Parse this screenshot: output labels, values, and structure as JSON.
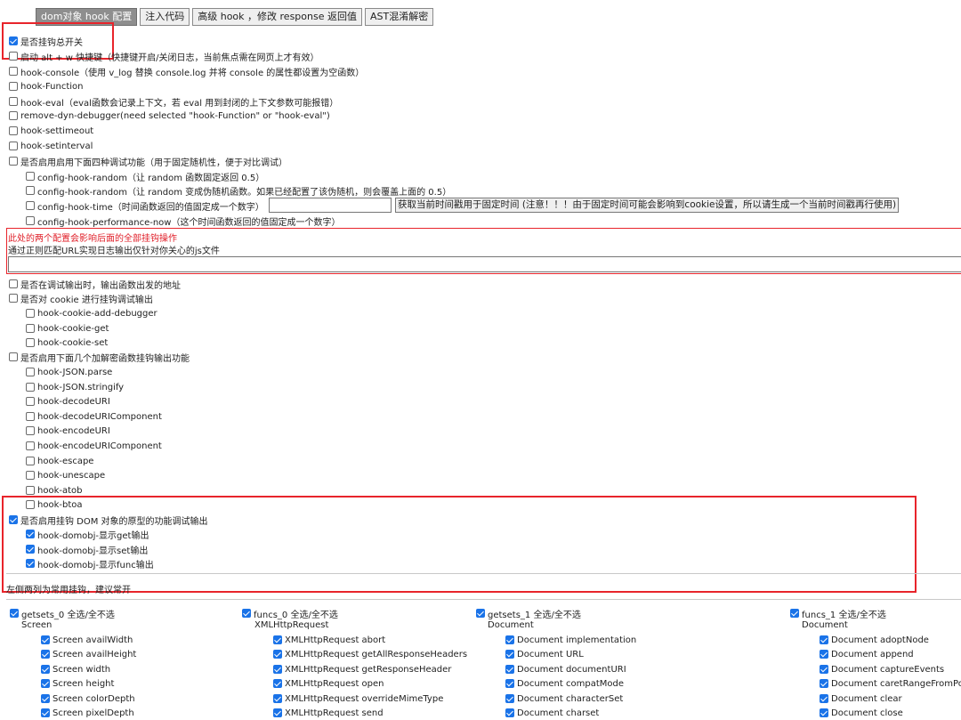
{
  "tabs": [
    {
      "label": "dom对象 hook 配置",
      "active": true
    },
    {
      "label": "注入代码",
      "active": false
    },
    {
      "label": "高级 hook ，修改 response 返回值",
      "active": false
    },
    {
      "label": "AST混淆解密",
      "active": false
    }
  ],
  "options": {
    "master": "是否挂钩总开关",
    "alt_w": "启动 alt + w 快捷键（快捷键开启/关闭日志，当前焦点需在网页上才有效）",
    "hook_console": "hook-console（使用 v_log 替换 console.log 并将 console 的属性都设置为空函数）",
    "hook_function": "hook-Function",
    "hook_eval": "hook-eval（eval函数会记录上下文，若 eval 用到封闭的上下文参数可能报错）",
    "remove_debugger": "remove-dyn-debugger(need selected \"hook-Function\" or \"hook-eval\")",
    "hook_settimeout": "hook-settimeout",
    "hook_setinterval": "hook-setinterval",
    "debug_group": "是否启用启用下面四种调试功能（用于固定随机性，便于对比调试）",
    "random1": "config-hook-random（让 random 函数固定返回 0.5）",
    "random2": "config-hook-random（让 random 变成伪随机函数。如果已经配置了该伪随机，则会覆盖上面的 0.5）",
    "time": "config-hook-time（时间函数返回的值固定成一个数字）",
    "time_button": "获取当前时间戳用于固定时间 (注意！！！由于固定时间可能会影响到cookie设置，所以请生成一个当前时间戳再行使用)",
    "perf_now": "config-hook-performance-now（这个时间函数返回的值固定成一个数字）",
    "warning": "此处的两个配置会影响后面的全部挂钩操作",
    "url_filter": "通过正则匹配URL实现日志输出仅针对你关心的js文件",
    "print_stack": "是否在调试输出时，输出函数出发的地址",
    "cookie_group": "是否对 cookie 进行挂钩调试输出",
    "cookie_items": [
      "hook-cookie-add-debugger",
      "hook-cookie-get",
      "hook-cookie-set"
    ],
    "crypto_group": "是否启用下面几个加解密函数挂钩输出功能",
    "crypto_items": [
      "hook-JSON.parse",
      "hook-JSON.stringify",
      "hook-decodeURI",
      "hook-decodeURIComponent",
      "hook-encodeURI",
      "hook-encodeURIComponent",
      "hook-escape",
      "hook-unescape",
      "hook-atob",
      "hook-btoa"
    ],
    "dom_group": "是否启用挂钩 DOM 对象的原型的功能调试输出",
    "dom_items": [
      "hook-domobj-显示get输出",
      "hook-domobj-显示set输出",
      "hook-domobj-显示func输出"
    ],
    "common_note": "左侧两列为常用挂钩，建议常开"
  },
  "columns": [
    {
      "toggle": "getsets_0 全选/全不选",
      "title": "Screen",
      "items": [
        "Screen availWidth",
        "Screen availHeight",
        "Screen width",
        "Screen height",
        "Screen colorDepth",
        "Screen pixelDepth"
      ]
    },
    {
      "toggle": "funcs_0 全选/全不选",
      "title": "XMLHttpRequest",
      "items": [
        "XMLHttpRequest abort",
        "XMLHttpRequest getAllResponseHeaders",
        "XMLHttpRequest getResponseHeader",
        "XMLHttpRequest open",
        "XMLHttpRequest overrideMimeType",
        "XMLHttpRequest send"
      ]
    },
    {
      "toggle": "getsets_1 全选/全不选",
      "title": "Document",
      "items": [
        "Document implementation",
        "Document URL",
        "Document documentURI",
        "Document compatMode",
        "Document characterSet",
        "Document charset"
      ]
    },
    {
      "toggle": "funcs_1 全选/全不选",
      "title": "Document",
      "items": [
        "Document adoptNode",
        "Document append",
        "Document captureEvents",
        "Document caretRangeFromPoint",
        "Document clear",
        "Document close"
      ]
    }
  ]
}
